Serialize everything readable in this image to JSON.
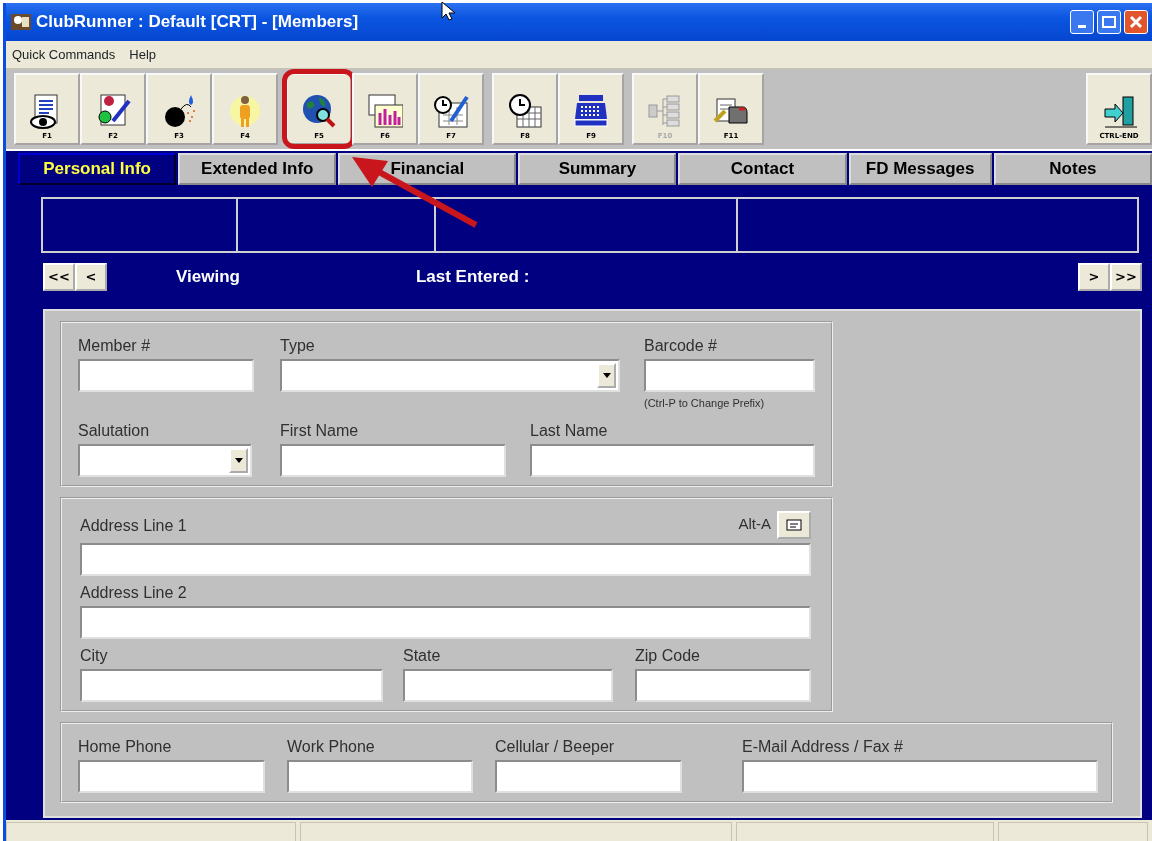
{
  "window": {
    "title": "ClubRunner : Default [CRT] - [Members]"
  },
  "menu": [
    "Quick Commands",
    "Help"
  ],
  "toolbar": [
    {
      "key": "F1",
      "disabled": false,
      "highlighted": false
    },
    {
      "key": "F2",
      "disabled": false,
      "highlighted": false
    },
    {
      "key": "F3",
      "disabled": false,
      "highlighted": false
    },
    {
      "key": "F4",
      "disabled": false,
      "highlighted": false
    },
    {
      "key": "F5",
      "disabled": false,
      "highlighted": true
    },
    {
      "key": "F6",
      "disabled": false,
      "highlighted": false
    },
    {
      "key": "F7",
      "disabled": false,
      "highlighted": false
    },
    {
      "key": "F8",
      "disabled": false,
      "highlighted": false
    },
    {
      "key": "F9",
      "disabled": false,
      "highlighted": false
    },
    {
      "key": "F10",
      "disabled": true,
      "highlighted": false
    },
    {
      "key": "F11",
      "disabled": false,
      "highlighted": false
    },
    {
      "key": "CTRL-END",
      "disabled": false,
      "highlighted": false
    }
  ],
  "tabs": [
    {
      "label": "Personal Info",
      "selected": true
    },
    {
      "label": "Extended Info",
      "selected": false
    },
    {
      "label": "Financial",
      "selected": false
    },
    {
      "label": "Summary",
      "selected": false
    },
    {
      "label": "Contact",
      "selected": false
    },
    {
      "label": "FD Messages",
      "selected": false
    },
    {
      "label": "Notes",
      "selected": false
    }
  ],
  "navigation": {
    "first": "<<",
    "previous": "<",
    "viewing": "Viewing",
    "last_entered": "Last Entered :",
    "next": ">",
    "last": ">>"
  },
  "groups": [
    {
      "rows": [
        [
          {
            "label": "Member #",
            "kind": "text"
          },
          {
            "label": "Type",
            "kind": "select"
          },
          {
            "label": "Barcode #",
            "kind": "text",
            "hint": "(Ctrl-P to Change Prefix)"
          }
        ],
        [
          {
            "label": "Salutation",
            "kind": "select"
          },
          {
            "label": "First Name",
            "kind": "text"
          },
          {
            "label": "Last Name",
            "kind": "text"
          }
        ]
      ]
    },
    {
      "rows": [
        [
          {
            "label": "Address Line 1",
            "kind": "text",
            "shortcut": "Alt-A"
          }
        ],
        [
          {
            "label": "Address Line 2",
            "kind": "text"
          }
        ],
        [
          {
            "label": "City",
            "kind": "text"
          },
          {
            "label": "State",
            "kind": "text"
          },
          {
            "label": "Zip Code",
            "kind": "text"
          }
        ]
      ]
    },
    {
      "rows": [
        [
          {
            "label": "Home Phone",
            "kind": "text"
          },
          {
            "label": "Work Phone",
            "kind": "text"
          },
          {
            "label": "Cellular / Beeper",
            "kind": "text"
          },
          {
            "label": "E-Mail Address / Fax #",
            "kind": "text"
          }
        ]
      ]
    }
  ]
}
